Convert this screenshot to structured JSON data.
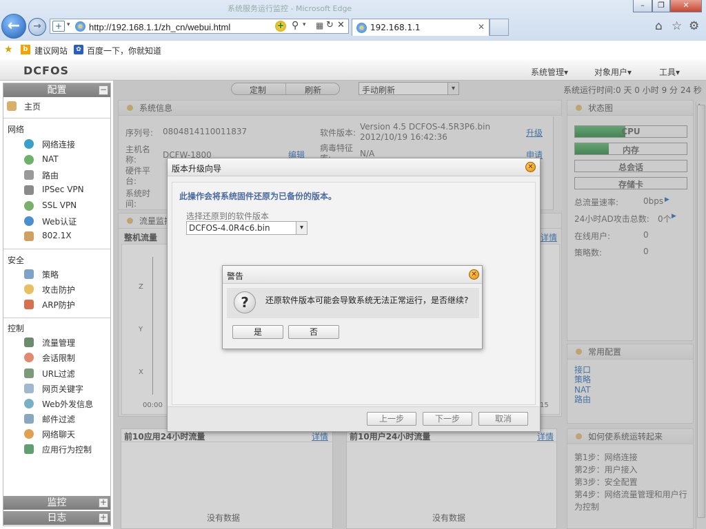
{
  "browser": {
    "window_title": "系统服务运行监控 - Microsoft Edge",
    "url": "http://192.168.1.1/zh_cn/webui.html",
    "tab_title": "192.168.1.1",
    "favorites": [
      "建议网站",
      "百度一下，你就知道"
    ]
  },
  "app": {
    "logo": "DCFOS",
    "top_menu": [
      "系统管理",
      "对象用户",
      "工具"
    ],
    "toolbar": {
      "customize": "定制",
      "refresh": "刷新",
      "refresh_mode": "手动刷新"
    },
    "uptime": "系统运行时间:0 天 0 小时 9 分 24 秒"
  },
  "sidebar": {
    "config_title": "配置",
    "home": "主页",
    "groups": [
      {
        "title": "网络",
        "items": [
          "网络连接",
          "NAT",
          "路由",
          "IPSec VPN",
          "SSL VPN",
          "Web认证",
          "802.1X"
        ]
      },
      {
        "title": "安全",
        "items": [
          "策略",
          "攻击防护",
          "ARP防护"
        ]
      },
      {
        "title": "控制",
        "items": [
          "流量管理",
          "会话限制",
          "URL过滤",
          "网页关键字",
          "Web外发信息",
          "邮件过滤",
          "网络聊天",
          "应用行为控制"
        ]
      }
    ],
    "monitor_title": "监控",
    "log_title": "日志"
  },
  "sysinfo": {
    "title": "系统信息",
    "serial_label": "序列号:",
    "serial": "0804814110011837",
    "hostname_label": "主机名称:",
    "hostname": "DCFW-1800",
    "hostname_action": "编辑",
    "platform_label": "硬件平台:",
    "systime_label": "系统时间:",
    "sw_label": "软件版本:",
    "sw_version": "Version 4.5 DCFOS-4.5R3P6.bin",
    "sw_date": "2012/10/19 16:42:36",
    "sw_action": "升级",
    "virus_label": "病毒特征库:",
    "virus_value": "N/A",
    "virus_action": "申请"
  },
  "traffic": {
    "title": "流量监控",
    "subtitle": "整机流量",
    "detail": "详情",
    "y_ticks": [
      "Z",
      "Y",
      "X"
    ],
    "x_start": "00:00",
    "x_end": "15"
  },
  "top_apps": {
    "title": "前10应用24小时流量",
    "detail": "详情",
    "empty": "没有数据"
  },
  "top_users": {
    "title": "前10用户24小时流量",
    "detail": "详情",
    "empty": "没有数据"
  },
  "status": {
    "title": "状态图",
    "bars": [
      {
        "label": "CPU",
        "level": 0.45
      },
      {
        "label": "内存",
        "level": 0.3
      },
      {
        "label": "总会话",
        "level": 0
      },
      {
        "label": "存储卡",
        "level": 0
      }
    ],
    "rows": [
      {
        "label": "总流量速率:",
        "value": "0bps"
      },
      {
        "label": "24小时AD攻击总数:",
        "value": "0个"
      },
      {
        "label": "在线用户:",
        "value": "0"
      },
      {
        "label": "策略数:",
        "value": "0"
      }
    ]
  },
  "common": {
    "title": "常用配置",
    "links": [
      "接口",
      "策略",
      "NAT",
      "路由"
    ]
  },
  "howto": {
    "title": "如何使系统运转起来",
    "steps": [
      "第1步：网络连接",
      "第2步：用户接入",
      "第3步：安全配置",
      "第4步：网络流量管理和用户行为控制"
    ]
  },
  "wizard": {
    "title": "版本升级向导",
    "notice": "此操作会将系统固件还原为已备份的版本。",
    "select_label": "选择还原到的软件版本",
    "select_value": "DCFOS-4.0R4c6.bin",
    "prev": "上一步",
    "next": "下一步",
    "cancel": "取消"
  },
  "alert": {
    "title": "警告",
    "message": "还原软件版本可能会导致系统无法正常运行，是否继续?",
    "yes": "是",
    "no": "否"
  },
  "colors": {
    "bar_fill": "#3f9a56",
    "link": "#2a6fb8",
    "accent_dot": "#e0b870",
    "notice_text": "#4a6aa0"
  }
}
